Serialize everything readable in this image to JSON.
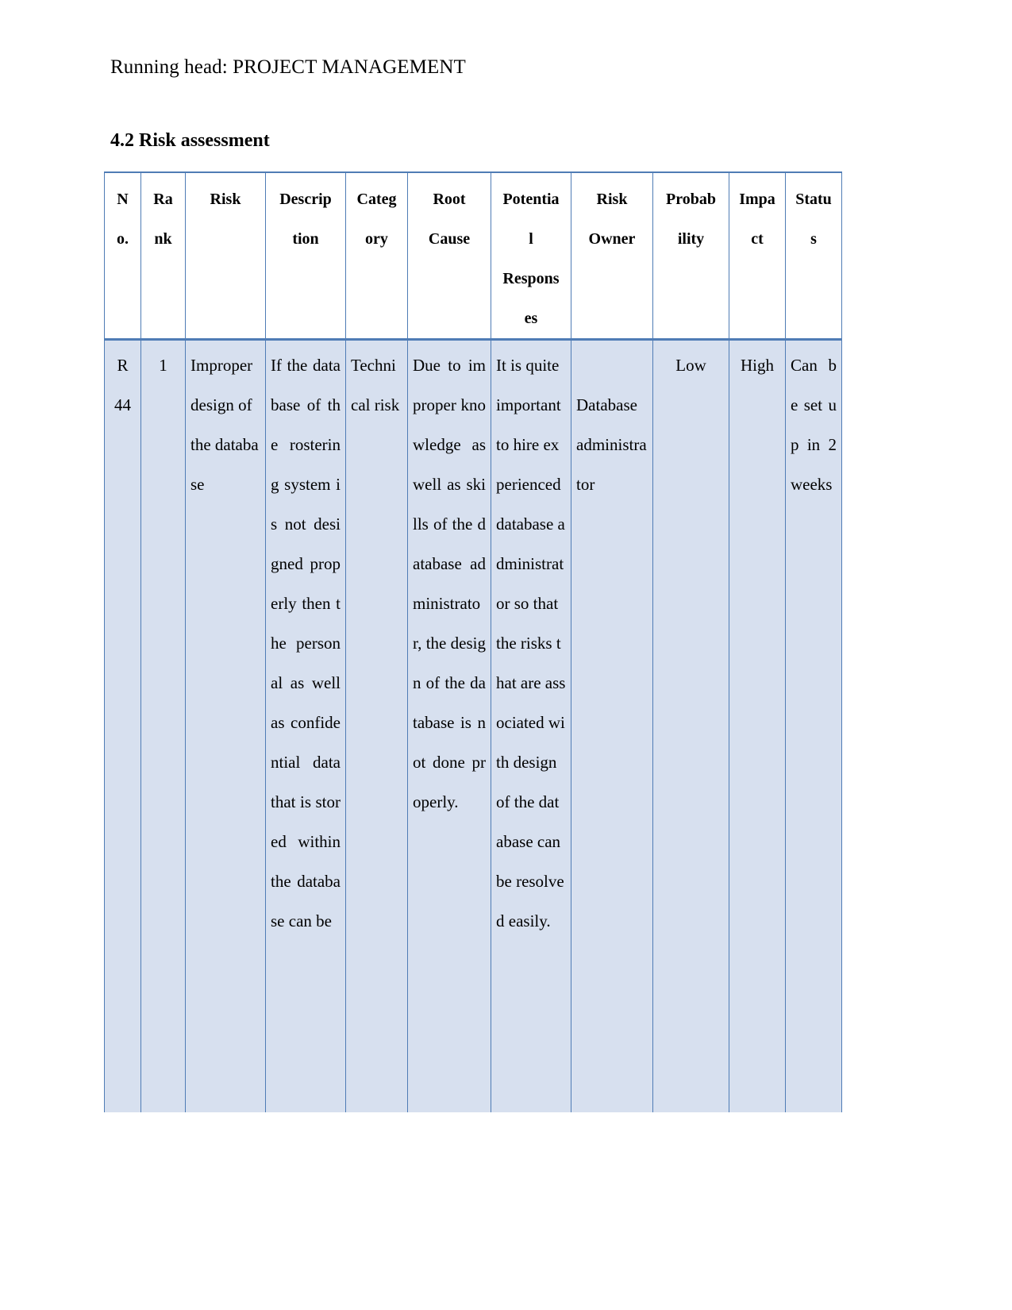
{
  "document": {
    "running_head": "Running head: PROJECT MANAGEMENT",
    "section_heading": "4.2 Risk assessment"
  },
  "colors": {
    "table_border": "#4f7cb5",
    "row_fill": "#d7e0ef",
    "page_background": "#ffffff",
    "text": "#000000"
  },
  "table": {
    "headers": [
      {
        "key": "no",
        "lines": [
          "N",
          "o."
        ]
      },
      {
        "key": "rank",
        "lines": [
          "Ra",
          "nk"
        ]
      },
      {
        "key": "risk",
        "lines": [
          "Risk"
        ]
      },
      {
        "key": "desc",
        "lines": [
          "Descrip",
          "tion"
        ]
      },
      {
        "key": "category",
        "lines": [
          "Categ",
          "ory"
        ]
      },
      {
        "key": "root",
        "lines": [
          "Root",
          "Cause"
        ]
      },
      {
        "key": "resp",
        "lines": [
          "Potentia",
          "l",
          "Respons",
          "es"
        ]
      },
      {
        "key": "owner",
        "lines": [
          "Risk",
          "Owner"
        ]
      },
      {
        "key": "prob",
        "lines": [
          "Probab",
          "ility"
        ]
      },
      {
        "key": "impact",
        "lines": [
          "Impa",
          "ct"
        ]
      },
      {
        "key": "status",
        "lines": [
          "Statu",
          "s"
        ]
      }
    ],
    "rows": [
      {
        "no": "R 44",
        "rank": "1",
        "risk": "Improper design of the database",
        "description": "If the database of the rostering system is not designed properly then the personal as well as confidential data that is stored within the database can be",
        "category": "Technical risk",
        "root_cause": "Due to improper knowledge as well as skills of the database administrator, the design of the database is not done properly.",
        "potential_responses": "It is quite important to hire experienced database administrator so that the risks that are associated with design of the database can be resolved easily.",
        "risk_owner": "Database administrator",
        "probability": "Low",
        "impact": "High",
        "status": "Can be set up in 2 weeks"
      }
    ]
  }
}
